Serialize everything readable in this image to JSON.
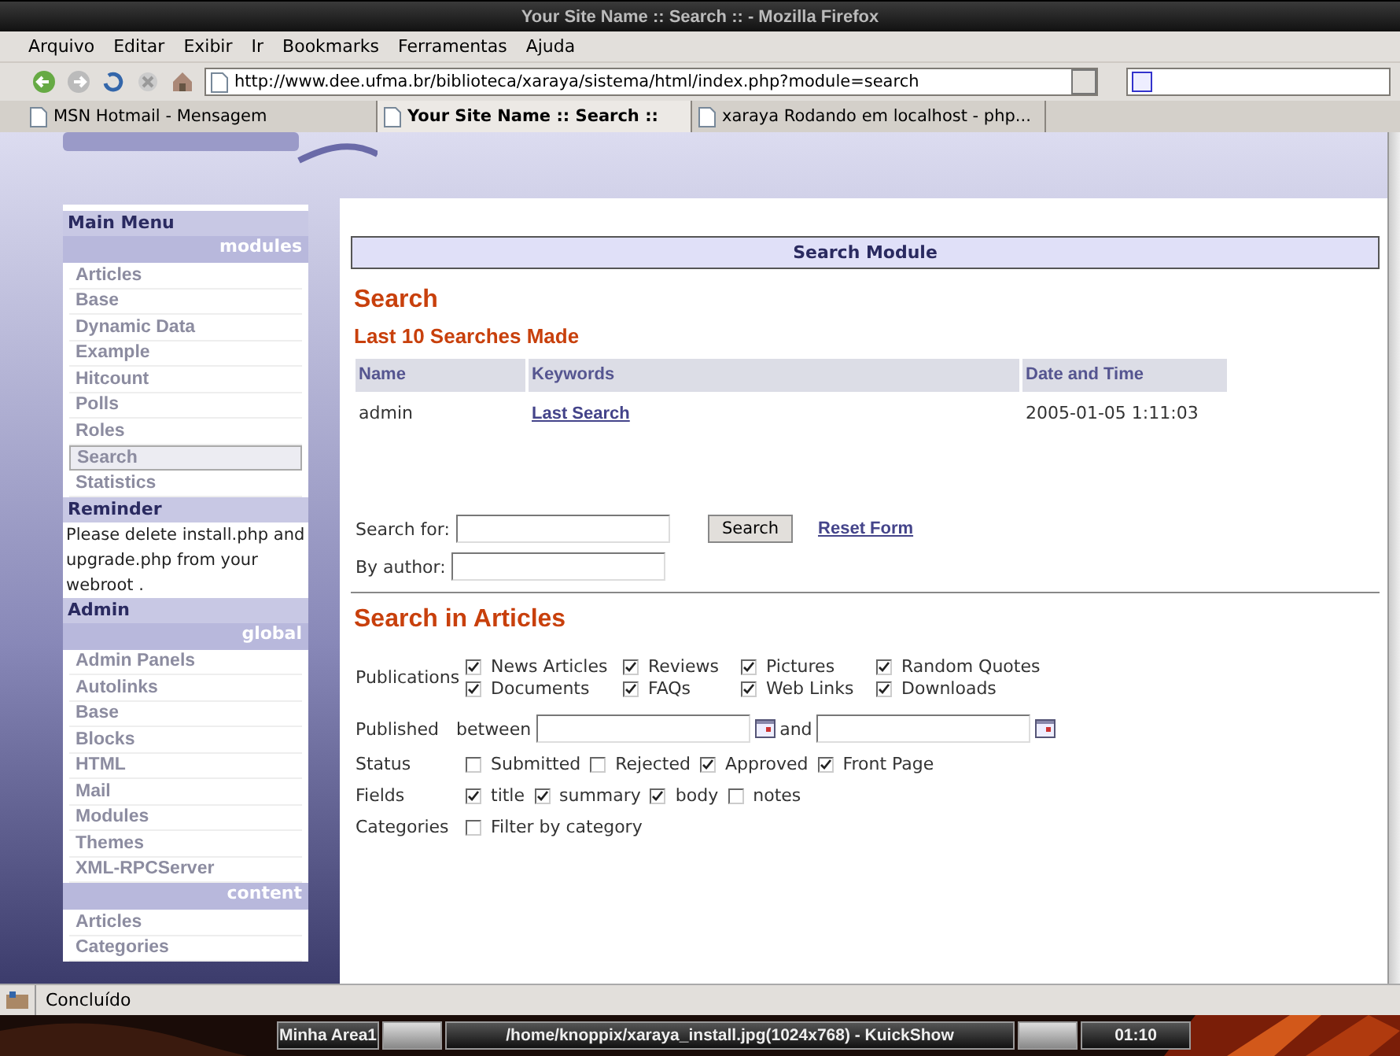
{
  "window": {
    "title": "Your Site Name :: Search :: - Mozilla Firefox"
  },
  "menu": [
    "Arquivo",
    "Editar",
    "Exibir",
    "Ir",
    "Bookmarks",
    "Ferramentas",
    "Ajuda"
  ],
  "address": {
    "value": "http://www.dee.ufma.br/biblioteca/xaraya/sistema/html/index.php?module=search"
  },
  "tabs": [
    {
      "label": "MSN Hotmail - Mensagem",
      "selected": false
    },
    {
      "label": "Your Site Name :: Search ::",
      "selected": true
    },
    {
      "label": "xaraya Rodando em localhost - php...",
      "selected": false
    }
  ],
  "sidebar": {
    "blocks": [
      {
        "title": "Main Menu",
        "sections": [
          {
            "label": "modules",
            "items": [
              {
                "label": "Articles",
                "selected": false
              },
              {
                "label": "Base",
                "selected": false
              },
              {
                "label": "Dynamic Data",
                "selected": false
              },
              {
                "label": "Example",
                "selected": false
              },
              {
                "label": "Hitcount",
                "selected": false
              },
              {
                "label": "Polls",
                "selected": false
              },
              {
                "label": "Roles",
                "selected": false
              },
              {
                "label": "Search",
                "selected": true
              },
              {
                "label": "Statistics",
                "selected": false
              }
            ]
          }
        ]
      },
      {
        "title": "Reminder",
        "text": "Please delete install.php and upgrade.php from your webroot ."
      },
      {
        "title": "Admin",
        "sections": [
          {
            "label": "global",
            "items": [
              {
                "label": "Admin Panels",
                "selected": false
              },
              {
                "label": "Autolinks",
                "selected": false
              },
              {
                "label": "Base",
                "selected": false
              },
              {
                "label": "Blocks",
                "selected": false
              },
              {
                "label": "HTML",
                "selected": false
              },
              {
                "label": "Mail",
                "selected": false
              },
              {
                "label": "Modules",
                "selected": false
              },
              {
                "label": "Themes",
                "selected": false
              },
              {
                "label": "XML-RPCServer",
                "selected": false
              }
            ]
          },
          {
            "label": "content",
            "items": [
              {
                "label": "Articles",
                "selected": false
              },
              {
                "label": "Categories",
                "selected": false
              }
            ]
          }
        ]
      }
    ]
  },
  "main": {
    "module_title": "Search Module",
    "heading": "Search",
    "subheading": "Last 10 Searches Made",
    "table": {
      "columns": [
        "Name",
        "Keywords",
        "Date and Time"
      ],
      "rows": [
        [
          "admin",
          "Last Search",
          "2005-01-05 1:11:03"
        ]
      ]
    },
    "search_for": {
      "label": "Search for:"
    },
    "search_button": "Search",
    "reset_link": "Reset Form",
    "by_author": {
      "label": "By author:"
    },
    "articles_heading": "Search in Articles",
    "publications": {
      "label": "Publications",
      "options": [
        {
          "label": "News Articles",
          "checked": true
        },
        {
          "label": "Reviews",
          "checked": true
        },
        {
          "label": "Pictures",
          "checked": true
        },
        {
          "label": "Random Quotes",
          "checked": true
        },
        {
          "label": "Documents",
          "checked": true
        },
        {
          "label": "FAQs",
          "checked": true
        },
        {
          "label": "Web Links",
          "checked": true
        },
        {
          "label": "Downloads",
          "checked": true
        }
      ]
    },
    "published": {
      "label": "Published",
      "between": "between",
      "and": "and"
    },
    "status": {
      "label": "Status",
      "options": [
        {
          "label": "Submitted",
          "checked": false
        },
        {
          "label": "Rejected",
          "checked": false
        },
        {
          "label": "Approved",
          "checked": true
        },
        {
          "label": "Front Page",
          "checked": true
        }
      ]
    },
    "fields": {
      "label": "Fields",
      "options": [
        {
          "label": "title",
          "checked": true
        },
        {
          "label": "summary",
          "checked": true
        },
        {
          "label": "body",
          "checked": true
        },
        {
          "label": "notes",
          "checked": false
        }
      ]
    },
    "categories": {
      "label": "Categories",
      "options": [
        {
          "label": "Filter by category",
          "checked": false
        }
      ]
    }
  },
  "status_bar": "Concluído",
  "taskbar": {
    "desktop": "Minha Area1",
    "task": "/home/knoppix/xaraya_install.jpg(1024x768) - KuickShow",
    "clock": "01:10"
  }
}
